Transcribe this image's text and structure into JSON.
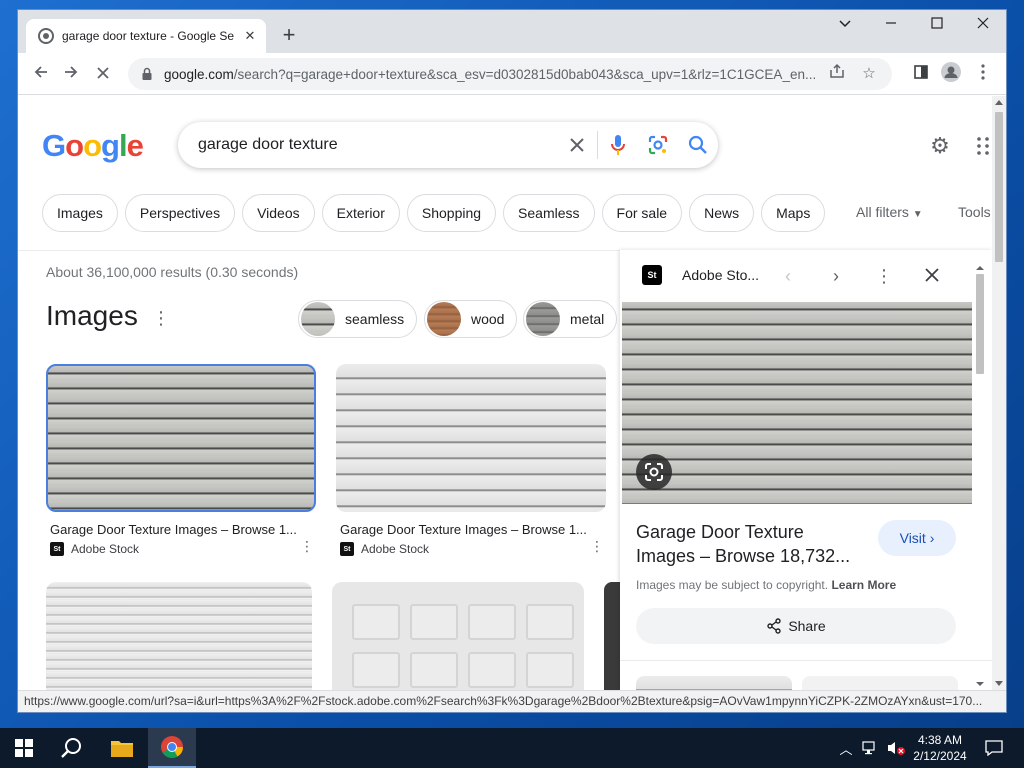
{
  "browser": {
    "tab_title": "garage door texture - Google Se",
    "url_host": "google.com",
    "url_rest": "/search?q=garage+door+texture&sca_esv=d0302815d0bab043&sca_upv=1&rlz=1C1GCEA_en...",
    "status_url": "https://www.google.com/url?sa=i&url=https%3A%2F%2Fstock.adobe.com%2Fsearch%3Fk%3Dgarage%2Bdoor%2Btexture&psig=AOvVaw1mpynnYiCZPK-2ZMOzAYxn&ust=170..."
  },
  "search": {
    "query": "garage door texture",
    "chips": [
      "Images",
      "Perspectives",
      "Videos",
      "Exterior",
      "Shopping",
      "Seamless",
      "For sale",
      "News",
      "Maps"
    ],
    "all_filters": "All filters",
    "tools": "Tools",
    "stats": "About 36,100,000 results (0.30 seconds)"
  },
  "images_section": {
    "heading": "Images",
    "refinements": [
      {
        "label": "seamless",
        "color": "#9a9a98"
      },
      {
        "label": "wood",
        "color": "#a8704c"
      },
      {
        "label": "metal",
        "color": "#8d8d8b"
      }
    ],
    "results": [
      {
        "caption": "Garage Door Texture Images – Browse 1...",
        "source": "Adobe Stock"
      },
      {
        "caption": "Garage Door Texture Images – Browse 1...",
        "source": "Adobe Stock"
      }
    ]
  },
  "side_panel": {
    "source": "Adobe Sto...",
    "title": "Garage Door Texture Images – Browse 18,732...",
    "visit": "Visit",
    "copyright": "Images may be subject to copyright.",
    "learn_more": "Learn More",
    "share": "Share"
  },
  "taskbar": {
    "time": "4:38 AM",
    "date": "2/12/2024"
  },
  "colors": {
    "accent": "#1a73e8",
    "taskbar": "#0d1a2b"
  }
}
